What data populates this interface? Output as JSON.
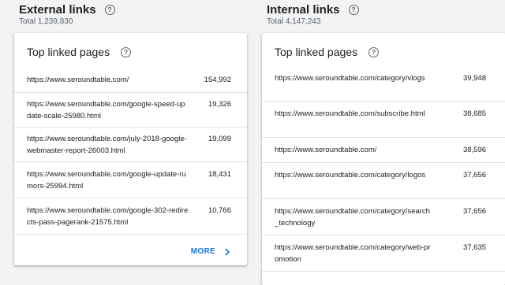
{
  "external": {
    "title": "External links",
    "total": "Total 1,239,830",
    "card_title": "Top linked pages",
    "rows": [
      {
        "url": "https://www.seroundtable.com/",
        "count": "154,992"
      },
      {
        "url": "https://www.seroundtable.com/google-speed-update-scale-25980.html",
        "count": "19,326"
      },
      {
        "url": "https://www.seroundtable.com/july-2018-google-webmaster-report-26003.html",
        "count": "19,099"
      },
      {
        "url": "https://www.seroundtable.com/google-update-rumors-25994.html",
        "count": "18,431"
      },
      {
        "url": "https://www.seroundtable.com/google-302-redirects-pass-pagerank-21575.html",
        "count": "10,766"
      }
    ],
    "more_label": "MORE"
  },
  "internal": {
    "title": "Internal links",
    "total": "Total 4,147,243",
    "card_title": "Top linked pages",
    "rows": [
      {
        "url": "https://www.seroundtable.com/category/vlogs",
        "count": "39,948"
      },
      {
        "url": "https://www.seroundtable.com/subscribe.html",
        "count": "38,685"
      },
      {
        "url": "https://www.seroundtable.com/",
        "count": "38,596"
      },
      {
        "url": "https://www.seroundtable.com/category/logos",
        "count": "37,656"
      },
      {
        "url": "https://www.seroundtable.com/category/search_technology",
        "count": "37,656"
      },
      {
        "url": "https://www.seroundtable.com/category/web-promotion",
        "count": "37,635"
      }
    ]
  },
  "help_icon_glyph": "?",
  "accent_color": "#1a73e8"
}
